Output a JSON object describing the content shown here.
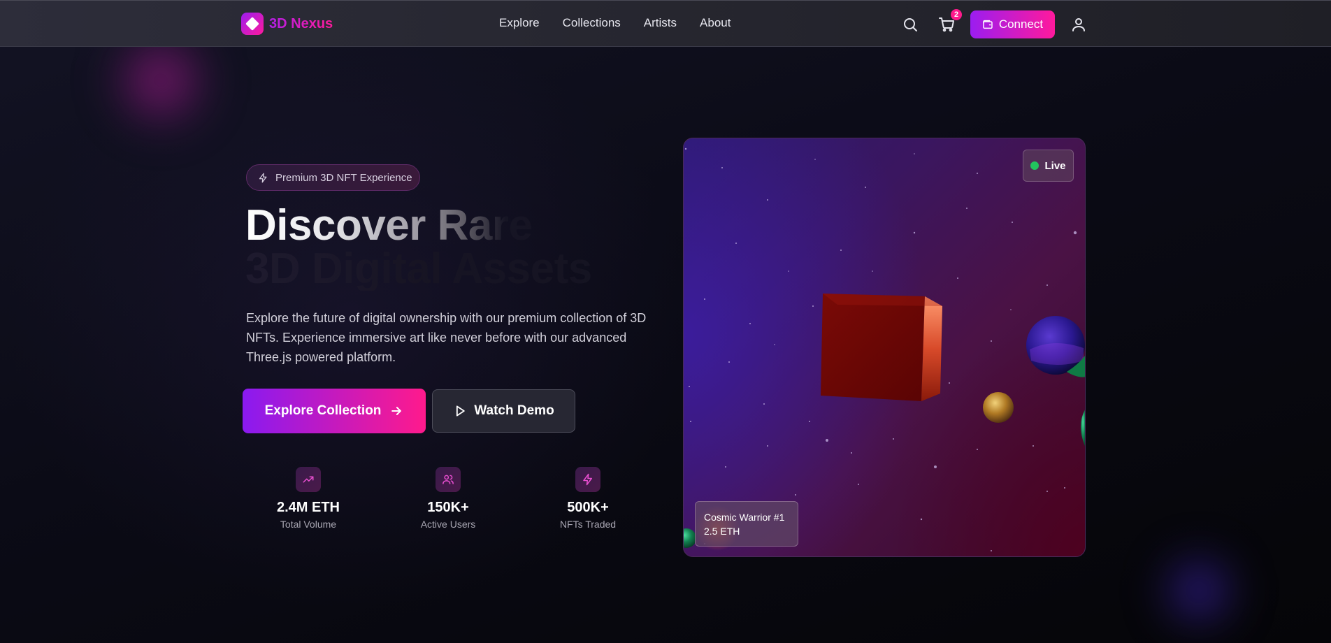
{
  "brand": {
    "name": "3D Nexus"
  },
  "nav": {
    "links": [
      "Explore",
      "Collections",
      "Artists",
      "About"
    ],
    "cart_count": "2",
    "connect_label": "Connect"
  },
  "hero": {
    "pill": "Premium 3D NFT Experience",
    "headline_line1": "Discover Rare",
    "headline_line2": "3D Digital Assets",
    "lead": "Explore the future of digital ownership with our premium collection of 3D NFTs. Experience immersive art like never before with our advanced Three.js powered platform.",
    "primary_cta": "Explore Collection",
    "secondary_cta": "Watch Demo"
  },
  "stats": [
    {
      "icon": "trending-up-icon",
      "value": "2.4M ETH",
      "label": "Total Volume"
    },
    {
      "icon": "users-icon",
      "value": "150K+",
      "label": "Active Users"
    },
    {
      "icon": "zap-icon",
      "value": "500K+",
      "label": "NFTs Traded"
    }
  ],
  "preview": {
    "status": "Live",
    "item_name": "Cosmic Warrior #1",
    "item_price": "2.5 ETH"
  },
  "colors": {
    "accent_start": "#9b1df0",
    "accent_end": "#ff1a9c",
    "live_dot": "#22c55e"
  }
}
